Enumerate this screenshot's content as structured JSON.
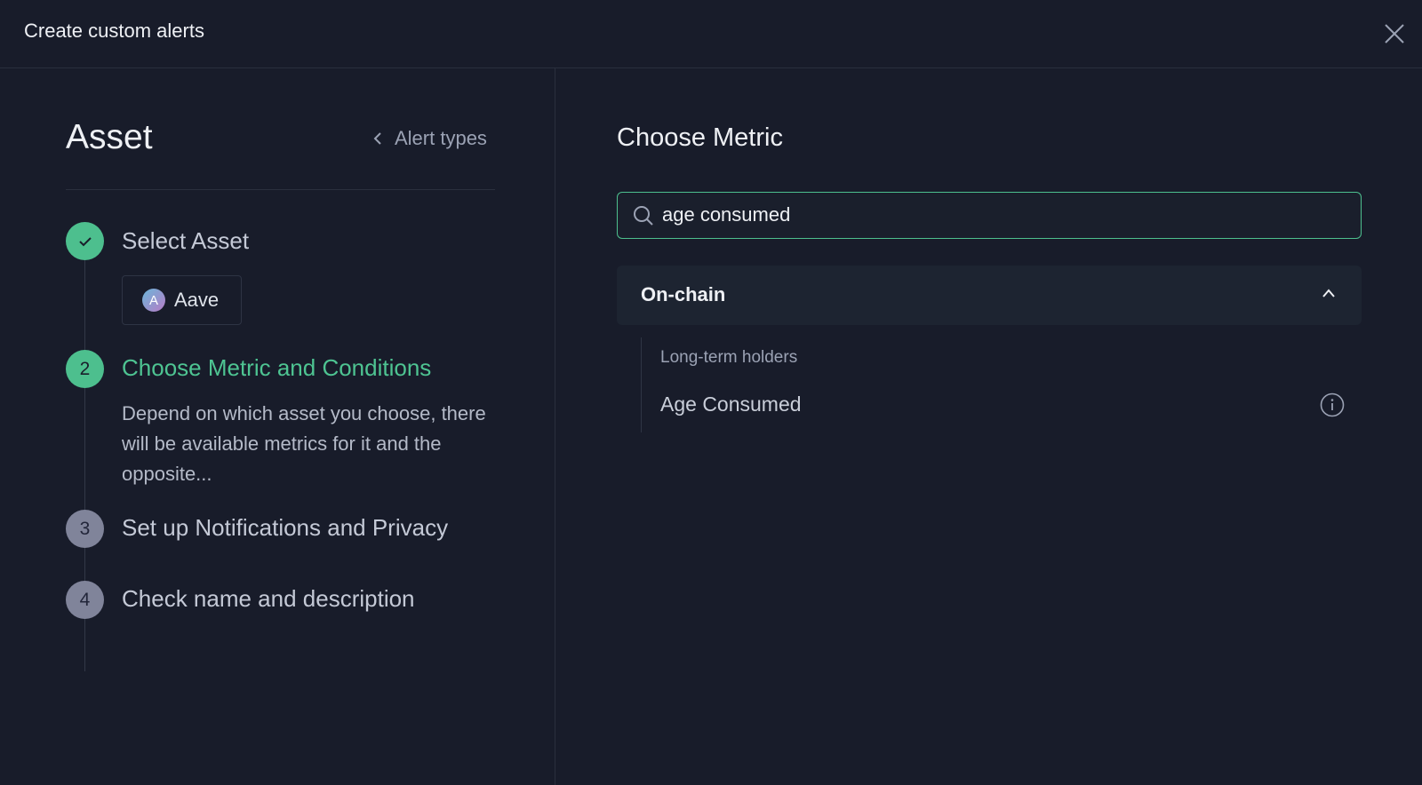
{
  "header": {
    "title": "Create custom alerts",
    "close_icon": "close-icon"
  },
  "left": {
    "title": "Asset",
    "back_link": "Alert types",
    "steps": [
      {
        "number": "",
        "label": "Select Asset",
        "state": "done"
      },
      {
        "number": "2",
        "label": "Choose Metric and Conditions",
        "state": "active",
        "description": "Depend on which asset you choose, there will be available metrics for it and the opposite..."
      },
      {
        "number": "3",
        "label": "Set up Notifications and Privacy",
        "state": "pending"
      },
      {
        "number": "4",
        "label": "Check name and description",
        "state": "pending"
      }
    ],
    "selected_asset": {
      "name": "Aave",
      "logo_letter": "A"
    }
  },
  "right": {
    "title": "Choose Metric",
    "search": {
      "value": "age consumed",
      "placeholder": ""
    },
    "groups": [
      {
        "title": "On-chain",
        "expanded": true,
        "subgroups": [
          {
            "label": "Long-term holders",
            "items": [
              {
                "label": "Age Consumed"
              }
            ]
          }
        ]
      }
    ]
  },
  "colors": {
    "background": "#181c2a",
    "accent": "#4dbf8e",
    "pending": "#80849a"
  }
}
